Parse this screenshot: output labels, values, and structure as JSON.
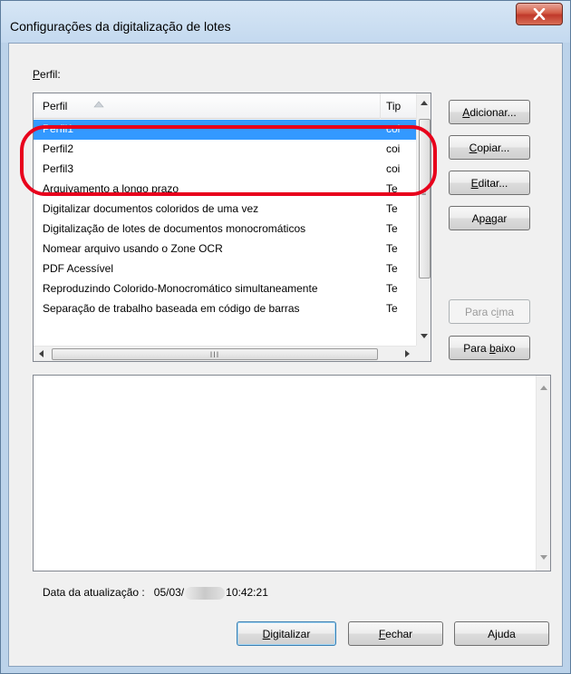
{
  "window": {
    "title": "Configurações da digitalização de lotes",
    "close_label": "X"
  },
  "profile_label": "Perfil:",
  "list": {
    "columns": [
      "Perfil",
      "Tip"
    ],
    "rows": [
      {
        "name": "Perfil1",
        "type": "coi",
        "selected": true
      },
      {
        "name": "Perfil2",
        "type": "coi",
        "selected": false
      },
      {
        "name": "Perfil3",
        "type": "coi",
        "selected": false
      },
      {
        "name": "Arquivamento a longo prazo",
        "type": "Te",
        "selected": false
      },
      {
        "name": "Digitalizar documentos coloridos de uma vez",
        "type": "Te",
        "selected": false
      },
      {
        "name": "Digitalização de lotes de documentos monocromáticos",
        "type": "Te",
        "selected": false
      },
      {
        "name": "Nomear arquivo usando o Zone OCR",
        "type": "Te",
        "selected": false
      },
      {
        "name": "PDF Acessível",
        "type": "Te",
        "selected": false
      },
      {
        "name": "Reproduzindo Colorido-Monocromático simultaneamente",
        "type": "Te",
        "selected": false
      },
      {
        "name": "Separação de trabalho baseada em código de barras",
        "type": "Te",
        "selected": false
      }
    ]
  },
  "side_buttons": {
    "add": "Adicionar...",
    "copy": "Copiar...",
    "edit": "Editar...",
    "delete": "Apagar",
    "move_up": "Para cima",
    "move_down": "Para baixo"
  },
  "description_text": "",
  "update": {
    "label": "Data da atualização :",
    "date_visible": "05/03/",
    "time": "10:42:21"
  },
  "bottom_buttons": {
    "scan": "Digitalizar",
    "close": "Fechar",
    "help": "Ajuda"
  },
  "colors": {
    "selection": "#3399ff",
    "highlight_oval": "#e8001c",
    "title_bar": "#c4d9ef",
    "close_button": "#c0392b"
  },
  "icons": {
    "close": "close-x-icon",
    "sort": "sort-ascending-icon",
    "scroll_up": "scroll-up-arrow-icon",
    "scroll_down": "scroll-down-arrow-icon",
    "scroll_left": "scroll-left-arrow-icon",
    "scroll_right": "scroll-right-arrow-icon"
  }
}
